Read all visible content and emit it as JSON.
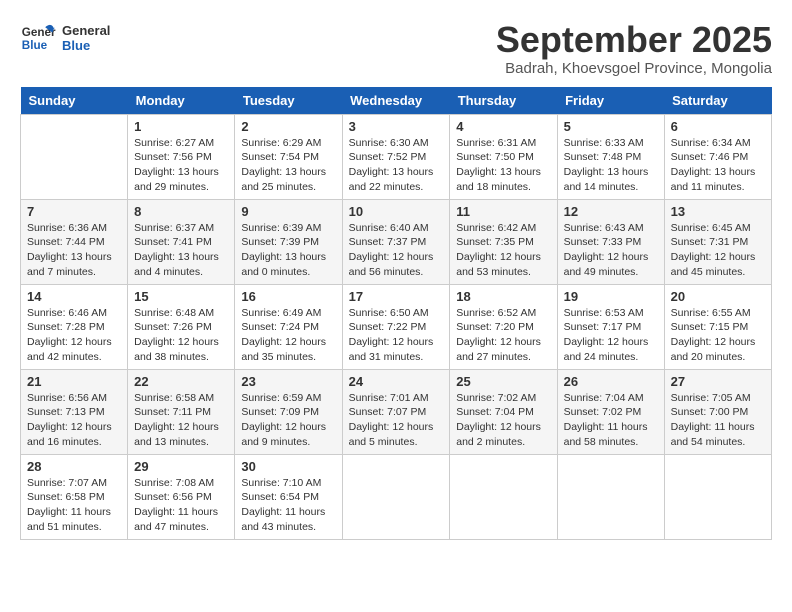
{
  "header": {
    "logo_line1": "General",
    "logo_line2": "Blue",
    "month": "September 2025",
    "location": "Badrah, Khoevsgoel Province, Mongolia"
  },
  "days": [
    "Sunday",
    "Monday",
    "Tuesday",
    "Wednesday",
    "Thursday",
    "Friday",
    "Saturday"
  ],
  "weeks": [
    [
      {
        "date": "",
        "sunrise": "",
        "sunset": "",
        "daylight": ""
      },
      {
        "date": "1",
        "sunrise": "Sunrise: 6:27 AM",
        "sunset": "Sunset: 7:56 PM",
        "daylight": "Daylight: 13 hours and 29 minutes."
      },
      {
        "date": "2",
        "sunrise": "Sunrise: 6:29 AM",
        "sunset": "Sunset: 7:54 PM",
        "daylight": "Daylight: 13 hours and 25 minutes."
      },
      {
        "date": "3",
        "sunrise": "Sunrise: 6:30 AM",
        "sunset": "Sunset: 7:52 PM",
        "daylight": "Daylight: 13 hours and 22 minutes."
      },
      {
        "date": "4",
        "sunrise": "Sunrise: 6:31 AM",
        "sunset": "Sunset: 7:50 PM",
        "daylight": "Daylight: 13 hours and 18 minutes."
      },
      {
        "date": "5",
        "sunrise": "Sunrise: 6:33 AM",
        "sunset": "Sunset: 7:48 PM",
        "daylight": "Daylight: 13 hours and 14 minutes."
      },
      {
        "date": "6",
        "sunrise": "Sunrise: 6:34 AM",
        "sunset": "Sunset: 7:46 PM",
        "daylight": "Daylight: 13 hours and 11 minutes."
      }
    ],
    [
      {
        "date": "7",
        "sunrise": "Sunrise: 6:36 AM",
        "sunset": "Sunset: 7:44 PM",
        "daylight": "Daylight: 13 hours and 7 minutes."
      },
      {
        "date": "8",
        "sunrise": "Sunrise: 6:37 AM",
        "sunset": "Sunset: 7:41 PM",
        "daylight": "Daylight: 13 hours and 4 minutes."
      },
      {
        "date": "9",
        "sunrise": "Sunrise: 6:39 AM",
        "sunset": "Sunset: 7:39 PM",
        "daylight": "Daylight: 13 hours and 0 minutes."
      },
      {
        "date": "10",
        "sunrise": "Sunrise: 6:40 AM",
        "sunset": "Sunset: 7:37 PM",
        "daylight": "Daylight: 12 hours and 56 minutes."
      },
      {
        "date": "11",
        "sunrise": "Sunrise: 6:42 AM",
        "sunset": "Sunset: 7:35 PM",
        "daylight": "Daylight: 12 hours and 53 minutes."
      },
      {
        "date": "12",
        "sunrise": "Sunrise: 6:43 AM",
        "sunset": "Sunset: 7:33 PM",
        "daylight": "Daylight: 12 hours and 49 minutes."
      },
      {
        "date": "13",
        "sunrise": "Sunrise: 6:45 AM",
        "sunset": "Sunset: 7:31 PM",
        "daylight": "Daylight: 12 hours and 45 minutes."
      }
    ],
    [
      {
        "date": "14",
        "sunrise": "Sunrise: 6:46 AM",
        "sunset": "Sunset: 7:28 PM",
        "daylight": "Daylight: 12 hours and 42 minutes."
      },
      {
        "date": "15",
        "sunrise": "Sunrise: 6:48 AM",
        "sunset": "Sunset: 7:26 PM",
        "daylight": "Daylight: 12 hours and 38 minutes."
      },
      {
        "date": "16",
        "sunrise": "Sunrise: 6:49 AM",
        "sunset": "Sunset: 7:24 PM",
        "daylight": "Daylight: 12 hours and 35 minutes."
      },
      {
        "date": "17",
        "sunrise": "Sunrise: 6:50 AM",
        "sunset": "Sunset: 7:22 PM",
        "daylight": "Daylight: 12 hours and 31 minutes."
      },
      {
        "date": "18",
        "sunrise": "Sunrise: 6:52 AM",
        "sunset": "Sunset: 7:20 PM",
        "daylight": "Daylight: 12 hours and 27 minutes."
      },
      {
        "date": "19",
        "sunrise": "Sunrise: 6:53 AM",
        "sunset": "Sunset: 7:17 PM",
        "daylight": "Daylight: 12 hours and 24 minutes."
      },
      {
        "date": "20",
        "sunrise": "Sunrise: 6:55 AM",
        "sunset": "Sunset: 7:15 PM",
        "daylight": "Daylight: 12 hours and 20 minutes."
      }
    ],
    [
      {
        "date": "21",
        "sunrise": "Sunrise: 6:56 AM",
        "sunset": "Sunset: 7:13 PM",
        "daylight": "Daylight: 12 hours and 16 minutes."
      },
      {
        "date": "22",
        "sunrise": "Sunrise: 6:58 AM",
        "sunset": "Sunset: 7:11 PM",
        "daylight": "Daylight: 12 hours and 13 minutes."
      },
      {
        "date": "23",
        "sunrise": "Sunrise: 6:59 AM",
        "sunset": "Sunset: 7:09 PM",
        "daylight": "Daylight: 12 hours and 9 minutes."
      },
      {
        "date": "24",
        "sunrise": "Sunrise: 7:01 AM",
        "sunset": "Sunset: 7:07 PM",
        "daylight": "Daylight: 12 hours and 5 minutes."
      },
      {
        "date": "25",
        "sunrise": "Sunrise: 7:02 AM",
        "sunset": "Sunset: 7:04 PM",
        "daylight": "Daylight: 12 hours and 2 minutes."
      },
      {
        "date": "26",
        "sunrise": "Sunrise: 7:04 AM",
        "sunset": "Sunset: 7:02 PM",
        "daylight": "Daylight: 11 hours and 58 minutes."
      },
      {
        "date": "27",
        "sunrise": "Sunrise: 7:05 AM",
        "sunset": "Sunset: 7:00 PM",
        "daylight": "Daylight: 11 hours and 54 minutes."
      }
    ],
    [
      {
        "date": "28",
        "sunrise": "Sunrise: 7:07 AM",
        "sunset": "Sunset: 6:58 PM",
        "daylight": "Daylight: 11 hours and 51 minutes."
      },
      {
        "date": "29",
        "sunrise": "Sunrise: 7:08 AM",
        "sunset": "Sunset: 6:56 PM",
        "daylight": "Daylight: 11 hours and 47 minutes."
      },
      {
        "date": "30",
        "sunrise": "Sunrise: 7:10 AM",
        "sunset": "Sunset: 6:54 PM",
        "daylight": "Daylight: 11 hours and 43 minutes."
      },
      {
        "date": "",
        "sunrise": "",
        "sunset": "",
        "daylight": ""
      },
      {
        "date": "",
        "sunrise": "",
        "sunset": "",
        "daylight": ""
      },
      {
        "date": "",
        "sunrise": "",
        "sunset": "",
        "daylight": ""
      },
      {
        "date": "",
        "sunrise": "",
        "sunset": "",
        "daylight": ""
      }
    ]
  ]
}
